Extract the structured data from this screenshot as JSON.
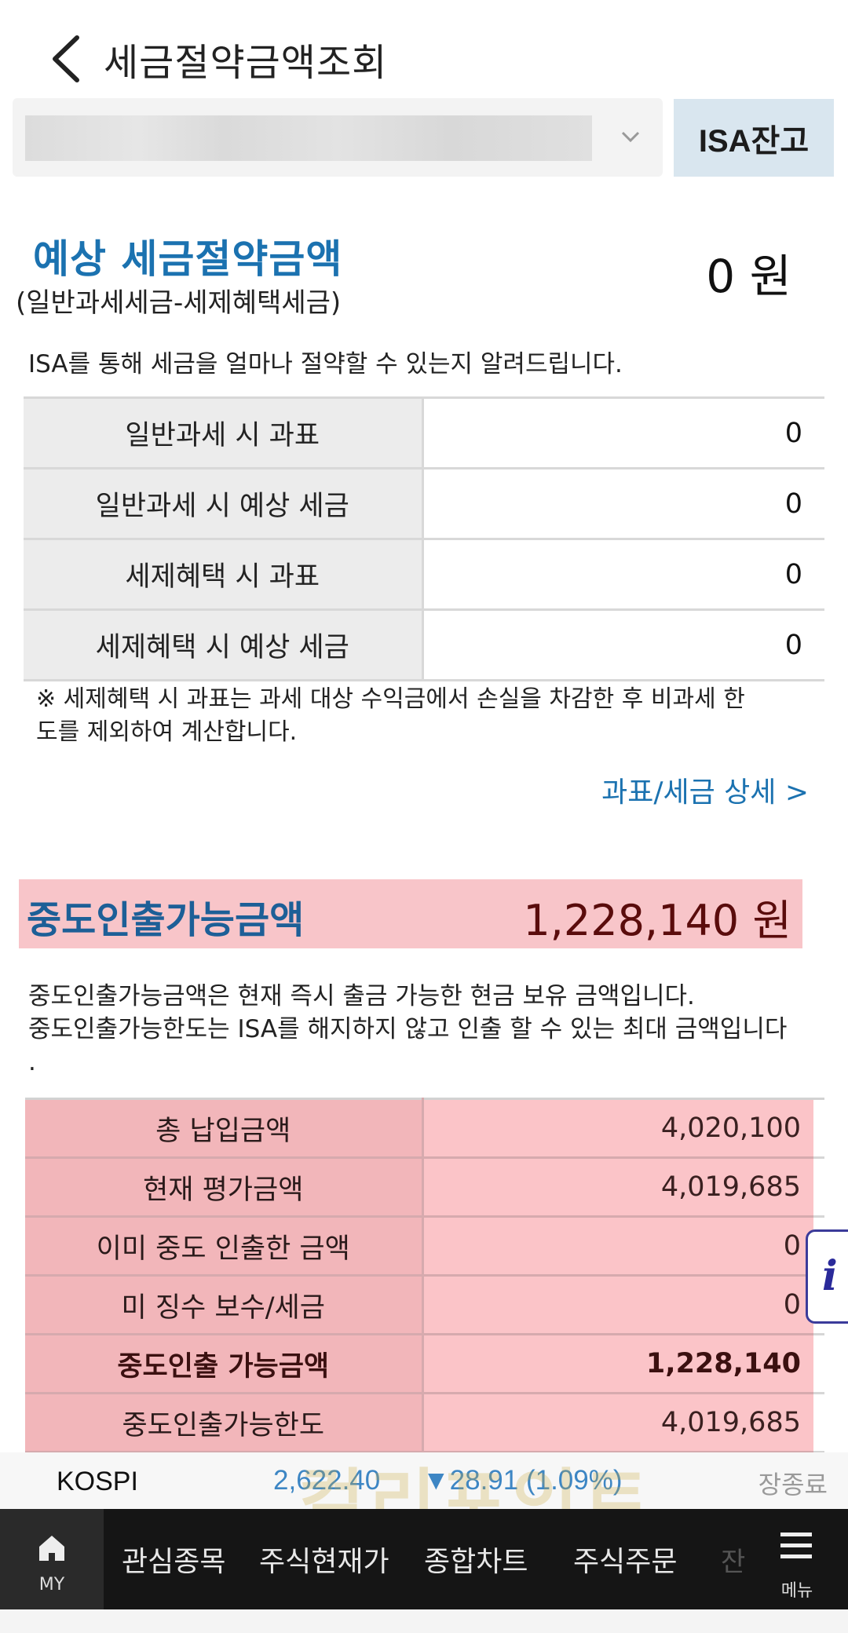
{
  "header": {
    "title": "세금절약금액조회"
  },
  "account": {
    "isa_button": "ISA잔고"
  },
  "saving": {
    "title": "예상 세금절약금액",
    "subtitle": "(일반과세세금-세제혜택세금)",
    "amount": "0 원",
    "description": "ISA를 통해 세금을 얼마나 절약할 수 있는지 알려드립니다.",
    "rows": [
      {
        "label": "일반과세 시 과표",
        "value": "0"
      },
      {
        "label": "일반과세 시 예상 세금",
        "value": "0"
      },
      {
        "label": "세제혜택 시 과표",
        "value": "0"
      },
      {
        "label": "세제혜택 시 예상 세금",
        "value": "0"
      }
    ],
    "note_line1": "※ 세제혜택 시 과표는 과세 대상 수익금에서 손실을 차감한 후 비과세 한",
    "note_line2": "도를 제외하여 계산합니다.",
    "detail_link": "과표/세금 상세 >"
  },
  "withdraw": {
    "title": "중도인출가능금액",
    "amount": "1,228,140 원",
    "desc_line1": "중도인출가능금액은 현재 즉시 출금 가능한 현금 보유 금액입니다.",
    "desc_line2": "중도인출가능한도는 ISA를 해지하지 않고 인출 할 수 있는 최대 금액입니다",
    "desc_line3": ".",
    "rows": [
      {
        "label": "총 납입금액",
        "value": "4,020,100"
      },
      {
        "label": "현재 평가금액",
        "value": "4,019,685"
      },
      {
        "label": "이미 중도 인출한 금액",
        "value": "0"
      },
      {
        "label": "미 징수 보수/세금",
        "value": "0"
      },
      {
        "label": "중도인출 가능금액",
        "value": "1,228,140"
      },
      {
        "label": "중도인출가능한도",
        "value": "4,019,685"
      }
    ]
  },
  "info_tab": {
    "label": "i"
  },
  "ticker": {
    "name": "KOSPI",
    "value": "2,622.40",
    "change": "▼28.91 (1.09%)",
    "status": "장종료"
  },
  "watermark": "컬리포인트",
  "nav": {
    "my_label": "MY",
    "items": [
      "관심종목",
      "주식현재가",
      "종합차트",
      "주식주문"
    ],
    "faded": "잔",
    "menu_label": "메뉴"
  },
  "colors": {
    "accent_blue": "#1b72b0",
    "highlight_pink": "#f8c5c9",
    "ticker_blue": "#3d86c4",
    "nav_bg": "#151515"
  }
}
